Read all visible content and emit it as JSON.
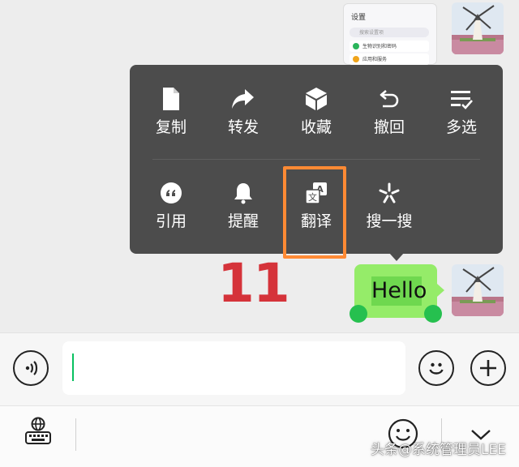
{
  "context_menu": {
    "row1": [
      {
        "label": "复制",
        "icon": "document-icon"
      },
      {
        "label": "转发",
        "icon": "forward-icon"
      },
      {
        "label": "收藏",
        "icon": "cube-icon"
      },
      {
        "label": "撤回",
        "icon": "undo-icon"
      },
      {
        "label": "多选",
        "icon": "multi-select-icon"
      }
    ],
    "row2": [
      {
        "label": "引用",
        "icon": "quote-icon"
      },
      {
        "label": "提醒",
        "icon": "bell-icon"
      },
      {
        "label": "翻译",
        "icon": "translate-icon"
      },
      {
        "label": "搜一搜",
        "icon": "search-spark-icon"
      }
    ]
  },
  "annotation": {
    "number": "11",
    "color": "#d5333a",
    "highlight_color": "#ff8a34"
  },
  "message": {
    "text": "Hello",
    "bubble_color": "#95ec69"
  },
  "thumbnail": {
    "title": "设置",
    "search_placeholder": "搜索设置项",
    "rows": [
      "生物识别和密码",
      "应用和服务"
    ]
  },
  "input": {
    "value": "",
    "cursor_color": "#07c160"
  },
  "watermark": {
    "prefix": "头条",
    "text": "@系统管理员LEE"
  }
}
